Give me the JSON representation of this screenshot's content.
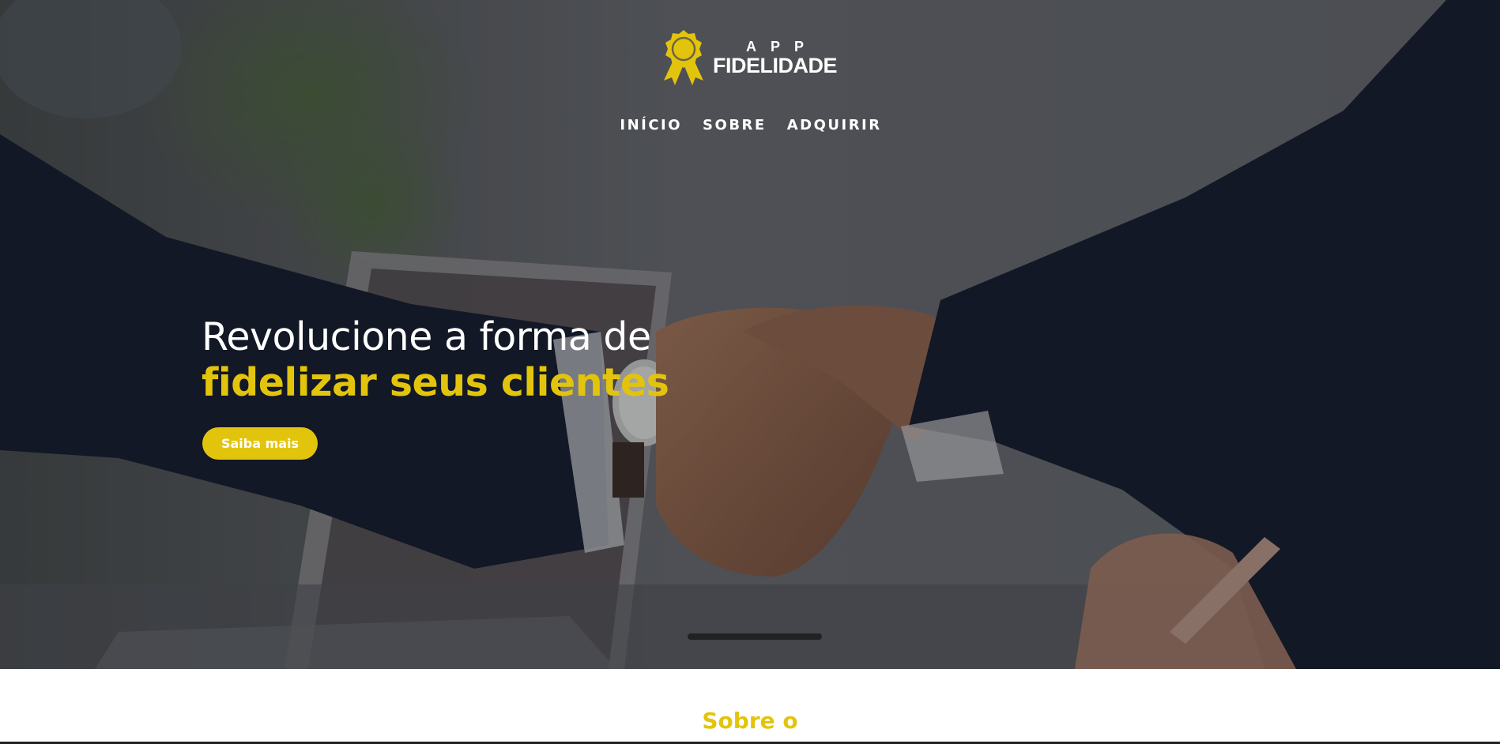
{
  "logo": {
    "line1": "APP",
    "line2": "FIDELIDADE",
    "icon": "award-ribbon-icon",
    "icon_color": "#e3c40d"
  },
  "nav": {
    "items": [
      {
        "label": "INÍCIO"
      },
      {
        "label": "SOBRE"
      },
      {
        "label": "ADQUIRIR"
      }
    ]
  },
  "hero": {
    "headline_line1": "Revolucione a forma de",
    "headline_line2": "fidelizar seus clientes",
    "cta_label": "Saiba mais",
    "accent_color": "#e3c40d",
    "background": "handshake-photo"
  },
  "about": {
    "title": "Sobre o"
  }
}
